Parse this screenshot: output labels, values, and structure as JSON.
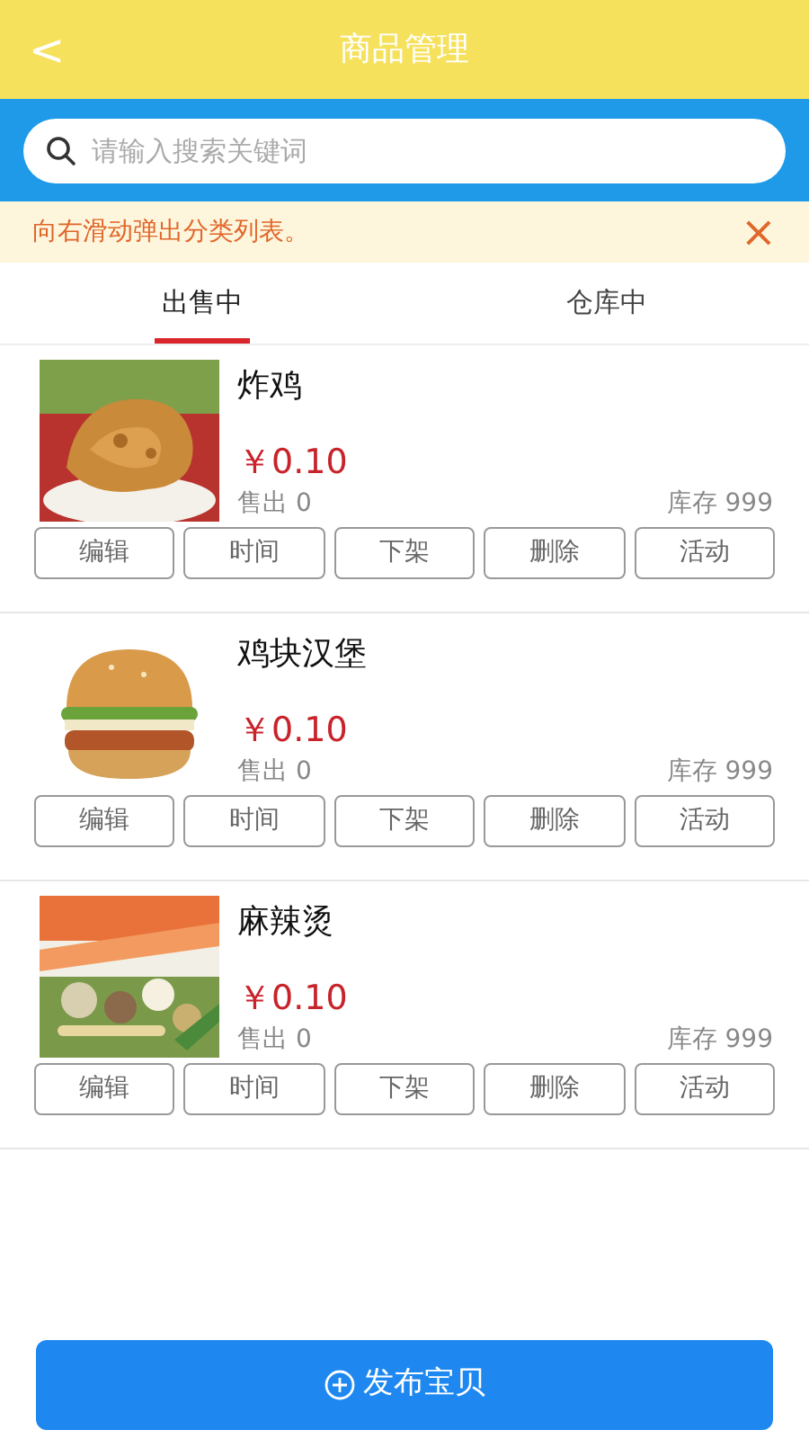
{
  "header": {
    "back": "<",
    "title": "商品管理"
  },
  "search": {
    "placeholder": "请输入搜索关键词"
  },
  "notice": {
    "text": "向右滑动弹出分类列表。",
    "close": "×"
  },
  "tabs": [
    {
      "label": "出售中",
      "selected": true
    },
    {
      "label": "仓库中",
      "selected": false
    }
  ],
  "products": [
    {
      "name": "炸鸡",
      "price": "￥0.10",
      "sold": "售出 0",
      "stock": "库存 999",
      "actions": [
        "编辑",
        "时间",
        "下架",
        "删除",
        "活动"
      ]
    },
    {
      "name": "鸡块汉堡",
      "price": "￥0.10",
      "sold": "售出 0",
      "stock": "库存 999",
      "actions": [
        "编辑",
        "时间",
        "下架",
        "删除",
        "活动"
      ]
    },
    {
      "name": "麻辣烫",
      "price": "￥0.10",
      "sold": "售出 0",
      "stock": "库存 999",
      "actions": [
        "编辑",
        "时间",
        "下架",
        "删除",
        "活动"
      ]
    }
  ],
  "publish_button": {
    "label": "发布宝贝"
  }
}
